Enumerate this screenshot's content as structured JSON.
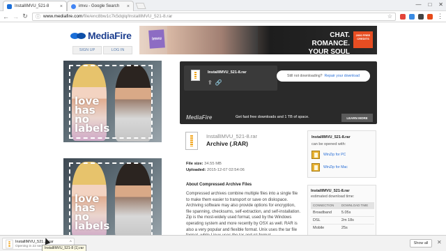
{
  "browser": {
    "tabs": [
      {
        "title": "InstallIMVU_521-8",
        "favicon_color": "#1a6ed8"
      },
      {
        "title": "imvu - Google Search",
        "favicon_color": "#4285f4"
      }
    ],
    "tab_close": "×",
    "window_controls": [
      "—",
      "□",
      "✕"
    ],
    "url_host": "www.mediafire.com",
    "url_path": "/file/enc8bw1c7k5dqlq/InstallIMVU_521-8.rar"
  },
  "site": {
    "logo_text": "MediaFire",
    "signup_label": "SIGN UP",
    "login_label": "LOG IN",
    "ad": {
      "brand": "imvu",
      "headline": "CHAT. ROMANCE. YOUR SOUL MATE.",
      "badge": "2000 FREE CREDITS"
    },
    "poster_words": [
      "love",
      "has",
      "no",
      "labels"
    ]
  },
  "download": {
    "filename": "InstallIMVU_521-8.rar",
    "repair_prefix": "Still not downloading?",
    "repair_link": "Repair your download",
    "brand": "MediaFire",
    "tagline": "Get fast free downloads and 1 TB of space.",
    "learn_more": "LEARN MORE"
  },
  "file": {
    "name": "InstallIMVU_521-8.rar",
    "type": "Archive (.RAR)",
    "size_label": "File size:",
    "size": "34.55 MB",
    "uploaded_label": "Uploaded:",
    "uploaded": "2015-12-07 02:54:06",
    "about_title": "About Compressed Archive Files",
    "about_text": "Compressed archives combine multiple files into a single file to make them easier to transport or save on diskspace. Archiving software may also provide options for encryption, file spanning, checksums, self-extraction, and self-installation. Zip is the most-widely used format, used by the Windows operating system and more recently by OSX as well. RAR is also a very popular and flexible format. Unix uses the tar file format, while Linux uses the tar and gz format."
  },
  "open_with": {
    "title": "InstallIMVU_521-8.rar",
    "subtitle": "can be opened with:",
    "apps": [
      "WinZip for PC",
      "WinZip for Mac"
    ]
  },
  "download_time": {
    "title": "InstallIMVU_521-8.rar",
    "subtitle": "estimated download time:",
    "headers": [
      "CONNECTION",
      "DOWNLOAD TIME"
    ],
    "rows": [
      [
        "Broadband",
        "5.05s"
      ],
      [
        "DSL",
        "2m 18s"
      ],
      [
        "Mobile",
        "25s"
      ]
    ]
  },
  "shelf": {
    "item_name": "InstallIMVU_521.....rar",
    "item_status": "Opening in 22 secs...",
    "tooltip": "InstallIMVU_521-8 (1).rar",
    "show_all": "Show all"
  }
}
